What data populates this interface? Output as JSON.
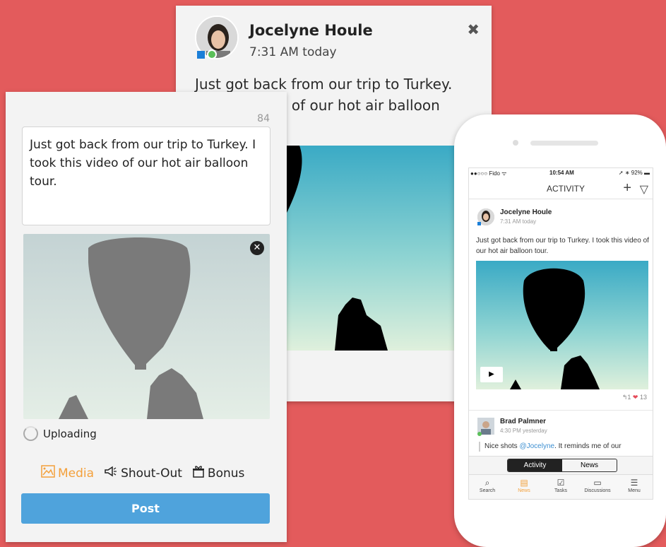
{
  "colors": {
    "background": "#e35b5c",
    "accent_orange": "#f3a03b",
    "post_button": "#4fa3dc",
    "status_online": "#5bc05a",
    "status_square": "#1b7fd8",
    "heart": "#e54b5a",
    "mention": "#3d8fd1"
  },
  "back_card": {
    "author_name": "Jocelyne Houle",
    "timestamp": "7:31 AM today",
    "text_line1": "Just got back from our trip to Turkey.",
    "text_line2": "eo of our hot air balloon",
    "close_icon": "close-x-icon"
  },
  "composer": {
    "char_counter": "84",
    "message": "Just got back from our trip to Turkey. I took this video of our hot air balloon tour.",
    "upload_status": "Uploading",
    "tools": {
      "media_label": "Media",
      "shoutout_label": "Shout-Out",
      "bonus_label": "Bonus"
    },
    "post_label": "Post"
  },
  "phone": {
    "status": {
      "carrier": "●●○○○ Fido ᯤ",
      "time": "10:54 AM",
      "battery": "➚ ∗ 92% ▬"
    },
    "header_title": "ACTIVITY",
    "feed": {
      "post1": {
        "author": "Jocelyne Houle",
        "time": "7:31 AM today",
        "text": "Just got back from our trip to Turkey. I took this video of our hot air balloon tour.",
        "reply_count": "1",
        "like_count": "13"
      },
      "post2": {
        "author": "Brad Palmner",
        "time": "4:30 PM yesterday",
        "text_before": "Nice shots ",
        "mention": "@Jocelyne",
        "text_after": ". It reminds me of our"
      }
    },
    "segment": {
      "activity": "Activity",
      "news": "News"
    },
    "tabs": [
      {
        "label": "Search",
        "icon": "search-icon"
      },
      {
        "label": "News",
        "icon": "news-icon"
      },
      {
        "label": "Tasks",
        "icon": "tasks-icon"
      },
      {
        "label": "Discussions",
        "icon": "discussions-icon"
      },
      {
        "label": "Menu",
        "icon": "menu-icon"
      }
    ]
  }
}
